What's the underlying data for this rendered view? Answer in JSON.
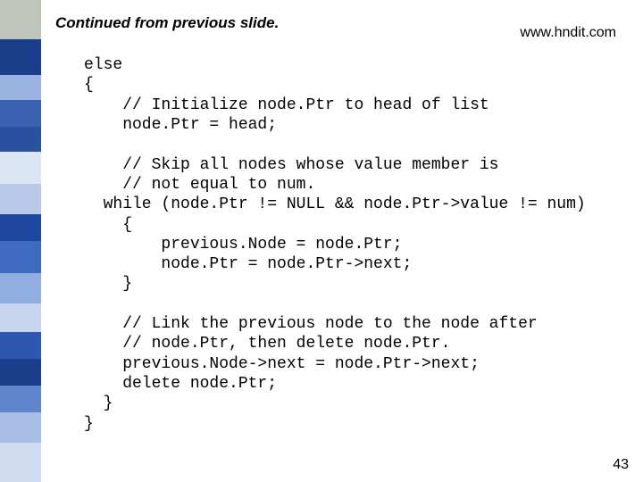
{
  "header": {
    "text": "Continued from previous slide."
  },
  "url": {
    "text": "www.hndit.com"
  },
  "code": {
    "l1": "else",
    "l2": "{",
    "l3": "    // Initialize node.Ptr to head of list",
    "l4": "    node.Ptr = head;",
    "l5": "",
    "l6": "    // Skip all nodes whose value member is",
    "l7": "    // not equal to num.",
    "l8": "  while (node.Ptr != NULL && node.Ptr->value != num)",
    "l9": "    {",
    "l10": "        previous.Node = node.Ptr;",
    "l11": "        node.Ptr = node.Ptr->next;",
    "l12": "    }",
    "l13": "",
    "l14": "    // Link the previous node to the node after",
    "l15": "    // node.Ptr, then delete node.Ptr.",
    "l16": "    previous.Node->next = node.Ptr->next;",
    "l17": "    delete node.Ptr;",
    "l18": "  }",
    "l19": "}"
  },
  "pagenum": {
    "text": "43"
  },
  "sidebar": {
    "colors": [
      "#c0c5bb",
      "#1a3e8a",
      "#9bb3e0",
      "#3a62b0",
      "#2a50a0",
      "#dbe5f4",
      "#b8cae8",
      "#1f47a0",
      "#3e6ac0",
      "#90aee0",
      "#c7d6ee",
      "#2e58b0",
      "#1a3e8a",
      "#5f86cc",
      "#a8bee6",
      "#d0dcf0"
    ],
    "heights": [
      44,
      40,
      28,
      30,
      28,
      36,
      34,
      30,
      36,
      34,
      32,
      30,
      30,
      30,
      34,
      44
    ]
  }
}
